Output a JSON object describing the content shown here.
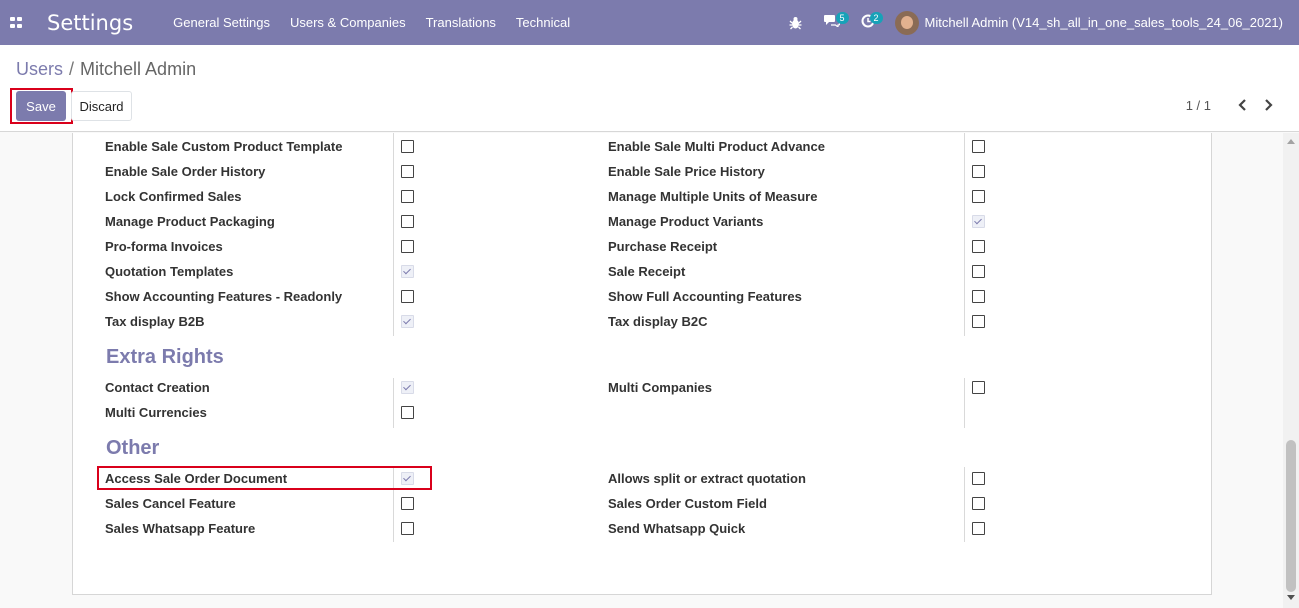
{
  "navbar": {
    "app_title": "Settings",
    "menu": [
      "General Settings",
      "Users & Companies",
      "Translations",
      "Technical"
    ],
    "chat_count": "5",
    "activity_count": "2",
    "user_name": "Mitchell Admin (V14_sh_all_in_one_sales_tools_24_06_2021)"
  },
  "breadcrumb": {
    "parent": "Users",
    "separator": "/",
    "current": "Mitchell Admin"
  },
  "buttons": {
    "save": "Save",
    "discard": "Discard"
  },
  "pager": {
    "value": "1 / 1"
  },
  "rights": [
    {
      "left": "Enable Sale Custom Product Template",
      "left_checked": false,
      "right": "Enable Sale Multi Product Advance",
      "right_checked": false
    },
    {
      "left": "Enable Sale Order History",
      "left_checked": false,
      "right": "Enable Sale Price History",
      "right_checked": false
    },
    {
      "left": "Lock Confirmed Sales",
      "left_checked": false,
      "right": "Manage Multiple Units of Measure",
      "right_checked": false
    },
    {
      "left": "Manage Product Packaging",
      "left_checked": false,
      "right": "Manage Product Variants",
      "right_checked": true
    },
    {
      "left": "Pro-forma Invoices",
      "left_checked": false,
      "right": "Purchase Receipt",
      "right_checked": false
    },
    {
      "left": "Quotation Templates",
      "left_checked": true,
      "right": "Sale Receipt",
      "right_checked": false
    },
    {
      "left": "Show Accounting Features - Readonly",
      "left_checked": false,
      "right": "Show Full Accounting Features",
      "right_checked": false
    },
    {
      "left": "Tax display B2B",
      "left_checked": true,
      "right": "Tax display B2C",
      "right_checked": false
    }
  ],
  "extra_rights": {
    "title": "Extra Rights",
    "rows": [
      {
        "left": "Contact Creation",
        "left_checked": true,
        "right": "Multi Companies",
        "right_checked": false
      },
      {
        "left": "Multi Currencies",
        "left_checked": false
      }
    ]
  },
  "other": {
    "title": "Other",
    "rows": [
      {
        "left": "Access Sale Order Document",
        "left_checked": true,
        "right": "Allows split or extract quotation",
        "right_checked": false
      },
      {
        "left": "Sales Cancel Feature",
        "left_checked": false,
        "right": "Sales Order Custom Field",
        "right_checked": false
      },
      {
        "left": "Sales Whatsapp Feature",
        "left_checked": false,
        "right": "Send Whatsapp Quick",
        "right_checked": false
      }
    ]
  },
  "colors": {
    "brand": "#7c7bad",
    "highlight": "#d9001b",
    "badge": "#17a2b8"
  }
}
